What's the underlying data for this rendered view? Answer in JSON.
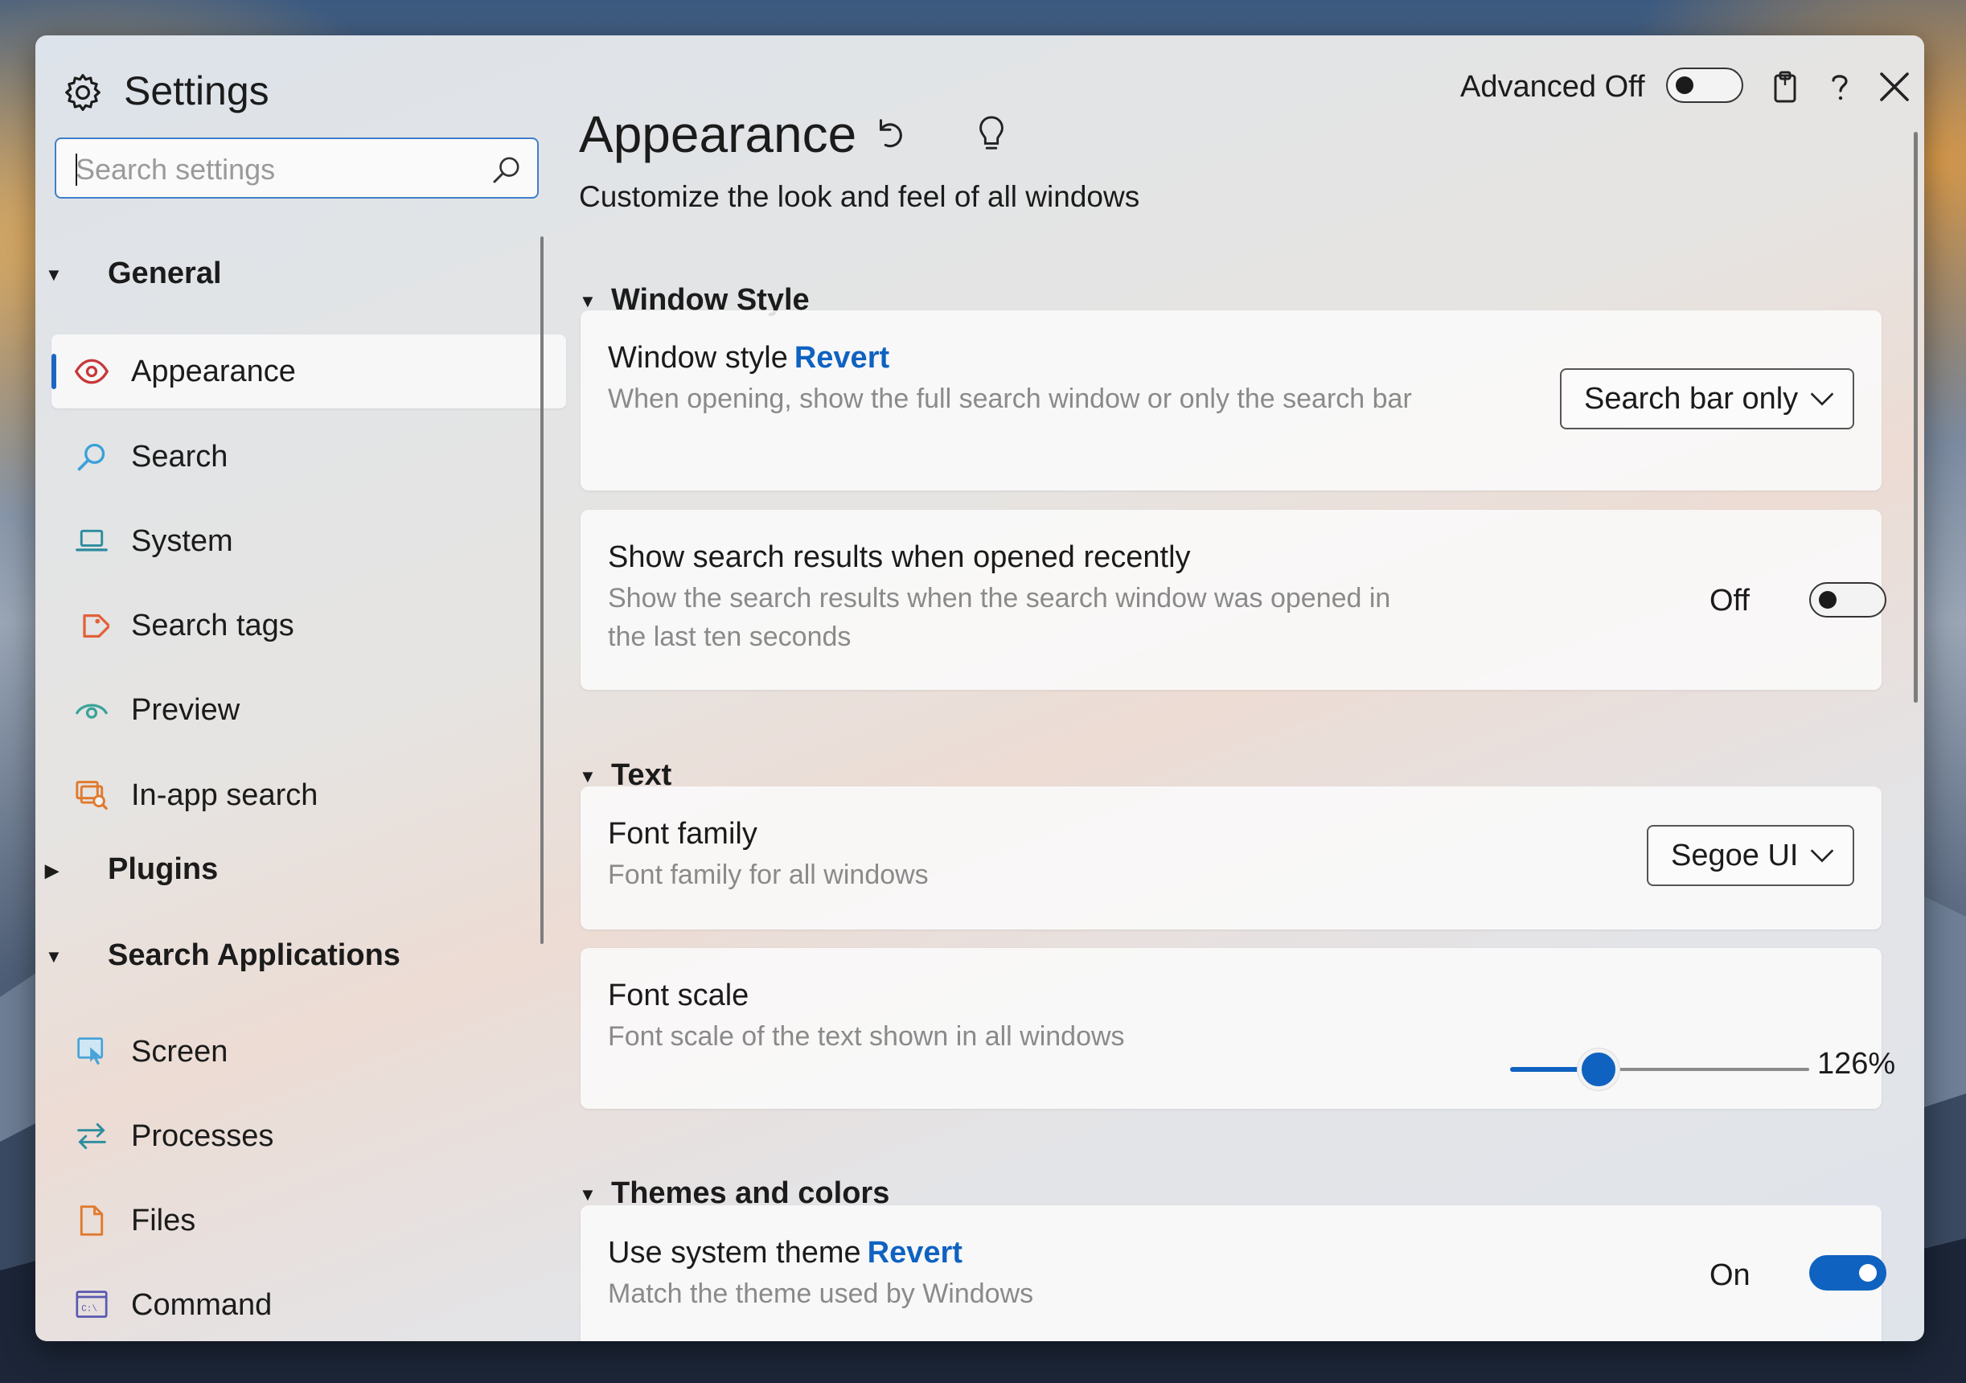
{
  "app": {
    "title": "Settings"
  },
  "search": {
    "placeholder": "Search settings",
    "value": ""
  },
  "header": {
    "advanced_label": "Advanced Off",
    "advanced_state": false
  },
  "sidebar": {
    "groups": [
      {
        "label": "General",
        "expanded": true
      },
      {
        "label": "Plugins",
        "expanded": false
      },
      {
        "label": "Search Applications",
        "expanded": true
      }
    ],
    "general_items": [
      {
        "label": "Appearance",
        "icon": "eye-icon",
        "selected": true
      },
      {
        "label": "Search",
        "icon": "search-icon"
      },
      {
        "label": "System",
        "icon": "laptop-icon"
      },
      {
        "label": "Search tags",
        "icon": "tag-icon"
      },
      {
        "label": "Preview",
        "icon": "preview-eye-icon"
      },
      {
        "label": "In-app search",
        "icon": "in-app-search-icon"
      }
    ],
    "app_items": [
      {
        "label": "Screen",
        "icon": "screen-icon"
      },
      {
        "label": "Processes",
        "icon": "processes-arrows-icon"
      },
      {
        "label": "Files",
        "icon": "file-icon"
      },
      {
        "label": "Command",
        "icon": "command-prompt-icon"
      }
    ]
  },
  "main": {
    "title": "Appearance",
    "subtitle": "Customize the look and feel of all windows",
    "sections": {
      "window_style": "Window Style",
      "text": "Text",
      "themes": "Themes and colors"
    },
    "settings": {
      "window_style": {
        "title": "Window style",
        "revert": "Revert",
        "desc": "When opening, show the full search window or only the search bar",
        "value": "Search bar only"
      },
      "recent": {
        "title": "Show search results when opened recently",
        "desc": "Show the search results when the search window was opened in the last ten seconds",
        "state_label": "Off",
        "state": false
      },
      "font_family": {
        "title": "Font family",
        "desc": "Font family for all windows",
        "value": "Segoe UI"
      },
      "font_scale": {
        "title": "Font scale",
        "desc": "Font scale of the text shown in all windows",
        "value_label": "126%",
        "fraction": 0.29
      },
      "system_theme": {
        "title": "Use system theme",
        "revert": "Revert",
        "desc": "Match the theme used by Windows",
        "state_label": "On",
        "state": true
      }
    }
  },
  "colors": {
    "accent": "#0f62c0",
    "revert": "#0f62c0",
    "selection_pill": "#1a67c2"
  }
}
